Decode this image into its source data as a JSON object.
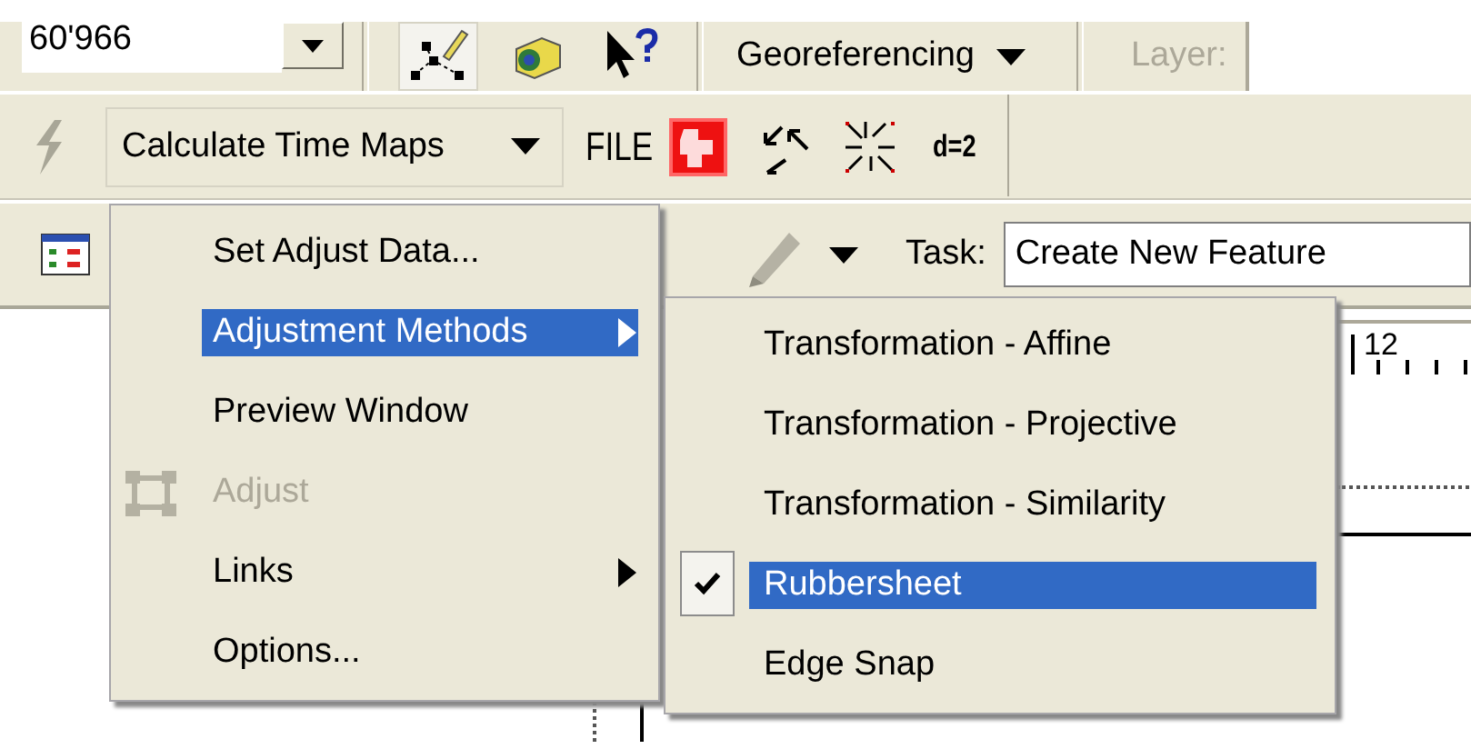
{
  "toolbar_top": {
    "scale_field": {
      "value": "60'966"
    },
    "georeferencing_menu": {
      "label": "Georeferencing"
    },
    "layer_label": {
      "text": "Layer:",
      "disabled": true
    }
  },
  "toolbar_middle": {
    "dropdown": {
      "label": "Calculate Time Maps"
    },
    "file_label": "FILE",
    "d_label": "d=2"
  },
  "toolbar_bottom": {
    "task_label": "Task:",
    "task_field": {
      "value": "Create New Feature"
    }
  },
  "ruler": {
    "tick_label": "12"
  },
  "menu": {
    "items": [
      {
        "label": "Set Adjust Data...",
        "kind": "command",
        "icon": false,
        "selected": false,
        "disabled": false
      },
      {
        "label": "Adjustment Methods",
        "kind": "submenu",
        "icon": false,
        "selected": true,
        "disabled": false
      },
      {
        "label": "Preview Window",
        "kind": "command",
        "icon": false,
        "selected": false,
        "disabled": false
      },
      {
        "label": "Adjust",
        "kind": "command",
        "icon": true,
        "selected": false,
        "disabled": true
      },
      {
        "label": "Links",
        "kind": "submenu",
        "icon": false,
        "selected": false,
        "disabled": false
      },
      {
        "label": "Options...",
        "kind": "command",
        "icon": false,
        "selected": false,
        "disabled": false
      }
    ]
  },
  "submenu": {
    "items": [
      {
        "label": "Transformation - Affine",
        "checked": false,
        "selected": false
      },
      {
        "label": "Transformation - Projective",
        "checked": false,
        "selected": false
      },
      {
        "label": "Transformation - Similarity",
        "checked": false,
        "selected": false
      },
      {
        "label": "Rubbersheet",
        "checked": true,
        "selected": true
      },
      {
        "label": "Edge Snap",
        "checked": false,
        "selected": false
      }
    ]
  }
}
